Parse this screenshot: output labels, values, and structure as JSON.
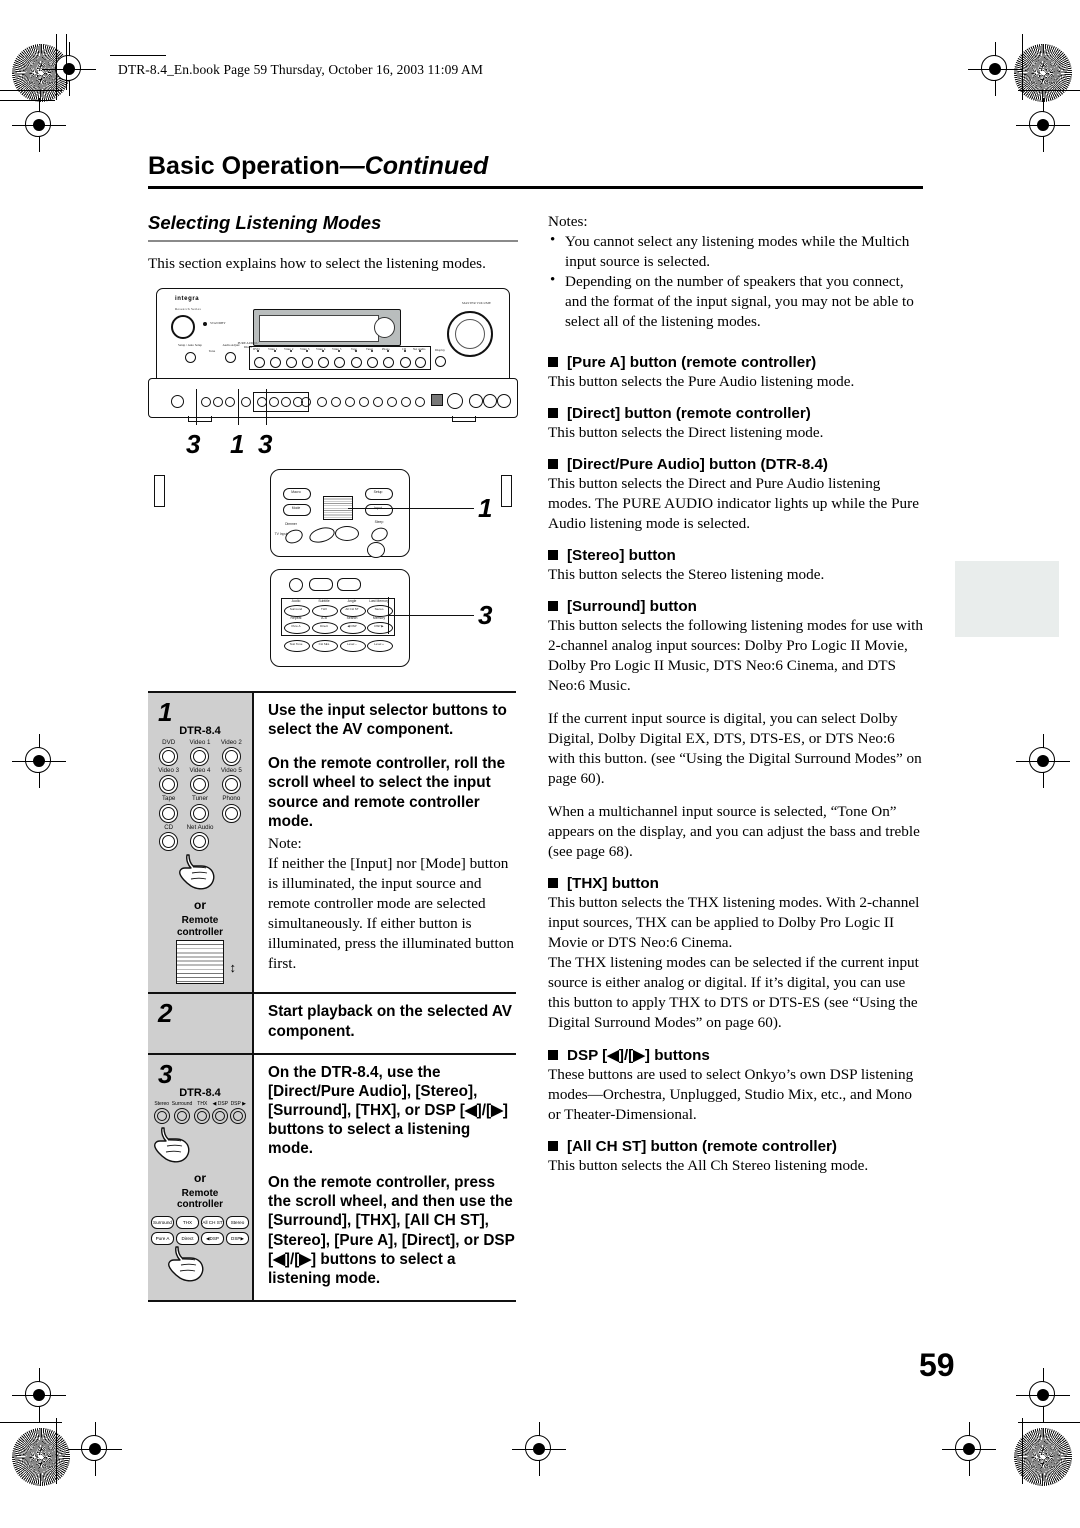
{
  "header": {
    "file_stamp": "DTR-8.4_En.book  Page 59  Thursday, October 16, 2003  11:09 AM",
    "chapter_title": "Basic Operation",
    "chapter_title_cont": "—Continued",
    "page_number": "59"
  },
  "left": {
    "section_title": "Selecting Listening Modes",
    "intro": "This section explains how to select the listening modes.",
    "receiver": {
      "brand": "integra",
      "sub_brand": "Research Series",
      "standby_label": "STANDBY",
      "master_volume_label": "MASTER VOLUME",
      "setup_label": "Setup / Auto Setup",
      "tone_label": "Tone",
      "audio_label": "Audio Adjust",
      "pure_label": "PURE AUDIO / Direct",
      "source_labels": [
        "DVD",
        "Video 1",
        "Video 2",
        "Video 3",
        "Video 4",
        "Video 5",
        "Tape",
        "Tuner",
        "Phono",
        "CD",
        "Net Audio"
      ],
      "mode_label": "Display"
    },
    "callouts": [
      "3",
      "1",
      "3"
    ],
    "remote_top": {
      "buttons": [
        "Macro",
        "Mode",
        "Input",
        "Setup",
        "Dimmer",
        "TV Input",
        "Sleep",
        "Left Shift",
        "Menu",
        "Display"
      ],
      "callout": "1"
    },
    "remote_bottom": {
      "top_labels": [
        "Audio",
        "Subtitle",
        "Angle",
        "Last Memory",
        "Repeat",
        "A-B",
        "Search",
        "Memory"
      ],
      "row1": [
        "Surround",
        "THX",
        "All CH ST",
        "Stereo"
      ],
      "row2": [
        "Pure A",
        "Direct",
        "◀ DSP",
        "DSP ▶"
      ],
      "row3": [
        "Test Tone",
        "CH SEL",
        "Level −",
        "Level +"
      ],
      "callout": "3"
    },
    "steps": [
      {
        "num": "1",
        "device_label": "DTR-8.4",
        "selectors": [
          "DVD",
          "Video 1",
          "Video 2",
          "Video 3",
          "Video 4",
          "Video 5",
          "Tape",
          "Tuner",
          "Phono",
          "CD",
          "Net Audio"
        ],
        "or": "or",
        "remote_label_1": "Remote",
        "remote_label_2": "controller",
        "heading_1": "Use the input selector buttons to select the AV component.",
        "heading_2": "On the remote controller, roll the scroll wheel to select the input source and remote controller mode.",
        "note_label": "Note:",
        "note_body": "If neither the [Input] nor [Mode] button is illuminated, the input source and remote controller mode are selected simultaneously. If either button is illuminated, press the illuminated button first."
      },
      {
        "num": "2",
        "heading_1": "Start playback on the selected AV component."
      },
      {
        "num": "3",
        "device_label": "DTR-8.4",
        "dtr_buttons": [
          "Stereo",
          "Surround",
          "THX",
          "◀ DSP",
          "DSP ▶"
        ],
        "or": "or",
        "remote_label_1": "Remote",
        "remote_label_2": "controller",
        "remote_buttons": [
          "Surround",
          "THX",
          "All CH ST",
          "Stereo",
          "Pure A",
          "Direct",
          "◀DSP",
          "DSP▶"
        ],
        "heading_1": "On the DTR-8.4, use the [Direct/Pure Audio], [Stereo], [Surround], [THX], or DSP [◀]/[▶] buttons to select a listening mode.",
        "heading_2": "On the remote controller, press the scroll wheel, and then use the [Surround], [THX], [All CH ST], [Stereo], [Pure A], [Direct], or DSP [◀]/[▶] buttons to select a listening mode."
      }
    ]
  },
  "right": {
    "notes_label": "Notes:",
    "notes": [
      "You cannot select any listening modes while the Multich input source is selected.",
      "Depending on the number of speakers that you connect, and the format of the input signal, you may not be able to select all of the listening modes."
    ],
    "sections": [
      {
        "heading": "[Pure A] button (remote controller)",
        "paragraphs": [
          "This button selects the Pure Audio listening mode."
        ]
      },
      {
        "heading": "[Direct] button (remote controller)",
        "paragraphs": [
          "This button selects the Direct listening mode."
        ]
      },
      {
        "heading": "[Direct/Pure Audio] button (DTR-8.4)",
        "paragraphs": [
          "This button selects the Direct and Pure Audio listening modes. The PURE AUDIO indicator lights up while the Pure Audio listening mode is selected."
        ]
      },
      {
        "heading": "[Stereo] button",
        "paragraphs": [
          "This button selects the Stereo listening mode."
        ]
      },
      {
        "heading": "[Surround] button",
        "paragraphs": [
          "This button selects the following listening modes for use with 2-channel analog input sources: Dolby Pro Logic II Movie, Dolby Pro Logic II Music, DTS Neo:6 Cinema, and DTS Neo:6 Music.",
          "If the current input source is digital, you can select Dolby Digital, Dolby Digital EX, DTS, DTS-ES, or DTS Neo:6 with this button. (see “Using the Digital Surround Modes” on page 60).",
          "When a multichannel input source is selected, “Tone On” appears on the display, and you can adjust the bass and treble (see page 68)."
        ]
      },
      {
        "heading": "[THX] button",
        "paragraphs": [
          "This button selects the THX listening modes. With 2-channel input sources, THX can be applied to Dolby Pro Logic II Movie or DTS Neo:6 Cinema.",
          "The THX listening modes can be selected if the current input source is either analog or digital. If it’s digital, you can use this button to apply THX to DTS or DTS-ES (see “Using the Digital Surround Modes” on page 60)."
        ]
      },
      {
        "heading": "DSP [◀]/[▶] buttons",
        "paragraphs": [
          "These buttons are used to select Onkyo’s own DSP listening modes—Orchestra, Unplugged, Studio Mix, etc., and Mono or Theater-Dimensional."
        ]
      },
      {
        "heading": "[All CH ST] button (remote controller)",
        "paragraphs": [
          "This button selects the All Ch Stereo listening mode."
        ]
      }
    ]
  }
}
